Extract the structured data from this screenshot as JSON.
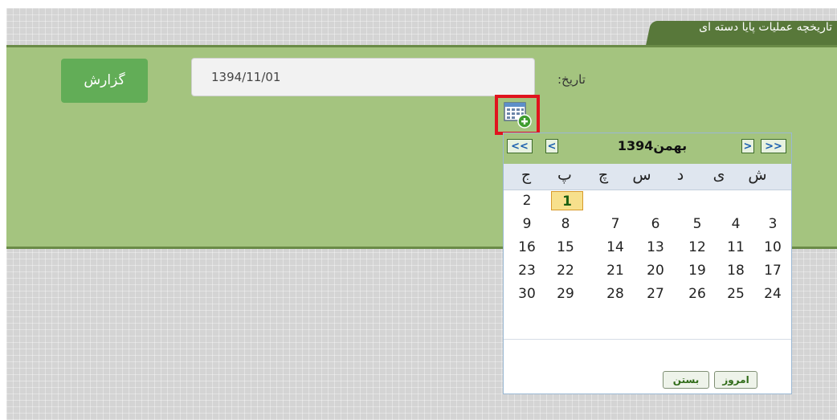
{
  "header": {
    "tab_title": "تاریخچه عملیات پایا دسته ای"
  },
  "form": {
    "report_button": "گزارش",
    "date_label": "تاریخ:",
    "date_value": "1394/11/01"
  },
  "calendar": {
    "month_title": "بهمن1394",
    "nav": {
      "prev_year": "<<",
      "prev_month": "<",
      "next_month": ">",
      "next_year": ">>"
    },
    "weekdays": [
      "ش",
      "ی",
      "د",
      "س",
      "چ",
      "پ",
      "ج"
    ],
    "weeks": [
      [
        "",
        "",
        "",
        "",
        "",
        "1",
        "2"
      ],
      [
        "3",
        "4",
        "5",
        "6",
        "7",
        "8",
        "9"
      ],
      [
        "10",
        "11",
        "12",
        "13",
        "14",
        "15",
        "16"
      ],
      [
        "17",
        "18",
        "19",
        "20",
        "21",
        "22",
        "23"
      ],
      [
        "24",
        "25",
        "26",
        "27",
        "28",
        "29",
        "30"
      ]
    ],
    "selected_day": "1",
    "footer": {
      "today": "امروز",
      "close": "بستن"
    }
  },
  "icons": {
    "calendar_button": "calendar-add-icon"
  },
  "colors": {
    "tab": "#58783a",
    "panel": "#a4c47f",
    "report_button": "#62ad57",
    "highlight": "#e0141e"
  }
}
